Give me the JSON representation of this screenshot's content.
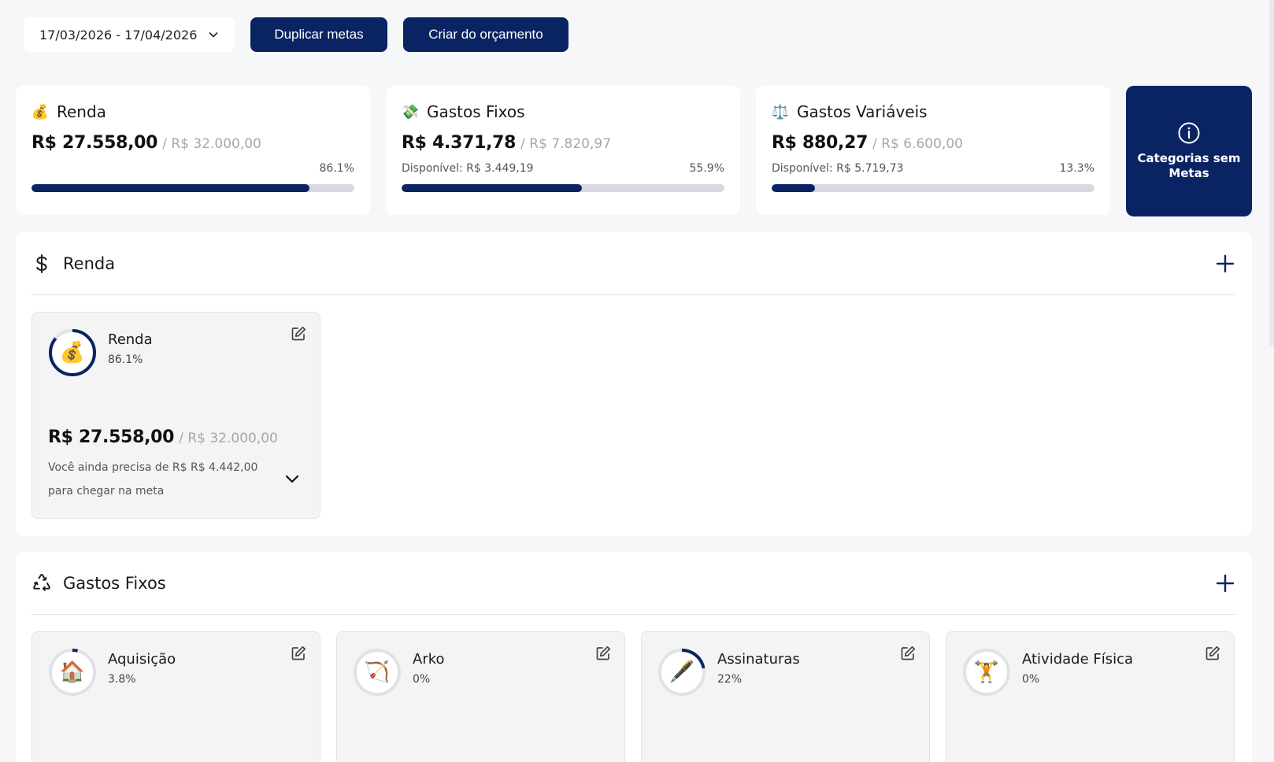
{
  "topbar": {
    "date_range": "17/03/2026 - 17/04/2026",
    "duplicate_label": "Duplicar metas",
    "create_label": "Criar do orçamento"
  },
  "summary": [
    {
      "emoji": "💰",
      "title": "Renda",
      "amount": "R$ 27.558,00",
      "goal": "/ R$ 32.000,00",
      "available": "",
      "percent_label": "86.1%",
      "percent": 86.1
    },
    {
      "emoji": "💸",
      "title": "Gastos Fixos",
      "amount": "R$ 4.371,78",
      "goal": "/ R$ 7.820,97",
      "available": "Disponível: R$ 3.449,19",
      "percent_label": "55.9%",
      "percent": 55.9
    },
    {
      "emoji": "⚖️",
      "title": "Gastos Variáveis",
      "amount": "R$ 880,27",
      "goal": "/ R$ 6.600,00",
      "available": "Disponível: R$ 5.719,73",
      "percent_label": "13.3%",
      "percent": 13.3
    }
  ],
  "no_goals_card": {
    "label": "Categorias sem Metas",
    "icon": "info-icon"
  },
  "sections": {
    "renda": {
      "title": "Renda",
      "icon": "dollar-icon",
      "cards": [
        {
          "name": "Renda",
          "emoji": "💰",
          "percent_label": "86.1%",
          "percent": 86.1,
          "amount": "R$ 27.558,00",
          "goal": "/ R$ 32.000,00",
          "need_text": "Você ainda precisa de R$ R$ 4.442,00 para chegar na meta"
        }
      ]
    },
    "fixos": {
      "title": "Gastos Fixos",
      "icon": "recycle-icon",
      "cards": [
        {
          "name": "Aquisição",
          "emoji": "🏠",
          "percent_label": "3.8%",
          "percent": 3.8
        },
        {
          "name": "Arko",
          "emoji": "🏹",
          "percent_label": "0%",
          "percent": 0
        },
        {
          "name": "Assinaturas",
          "emoji": "🖋️",
          "percent_label": "22%",
          "percent": 22
        },
        {
          "name": "Atividade Física",
          "emoji": "🏋️",
          "percent_label": "0%",
          "percent": 0
        }
      ]
    }
  },
  "colors": {
    "accent": "#0a2463",
    "track": "#d7d9de",
    "card_bg": "#f4f4f5"
  }
}
